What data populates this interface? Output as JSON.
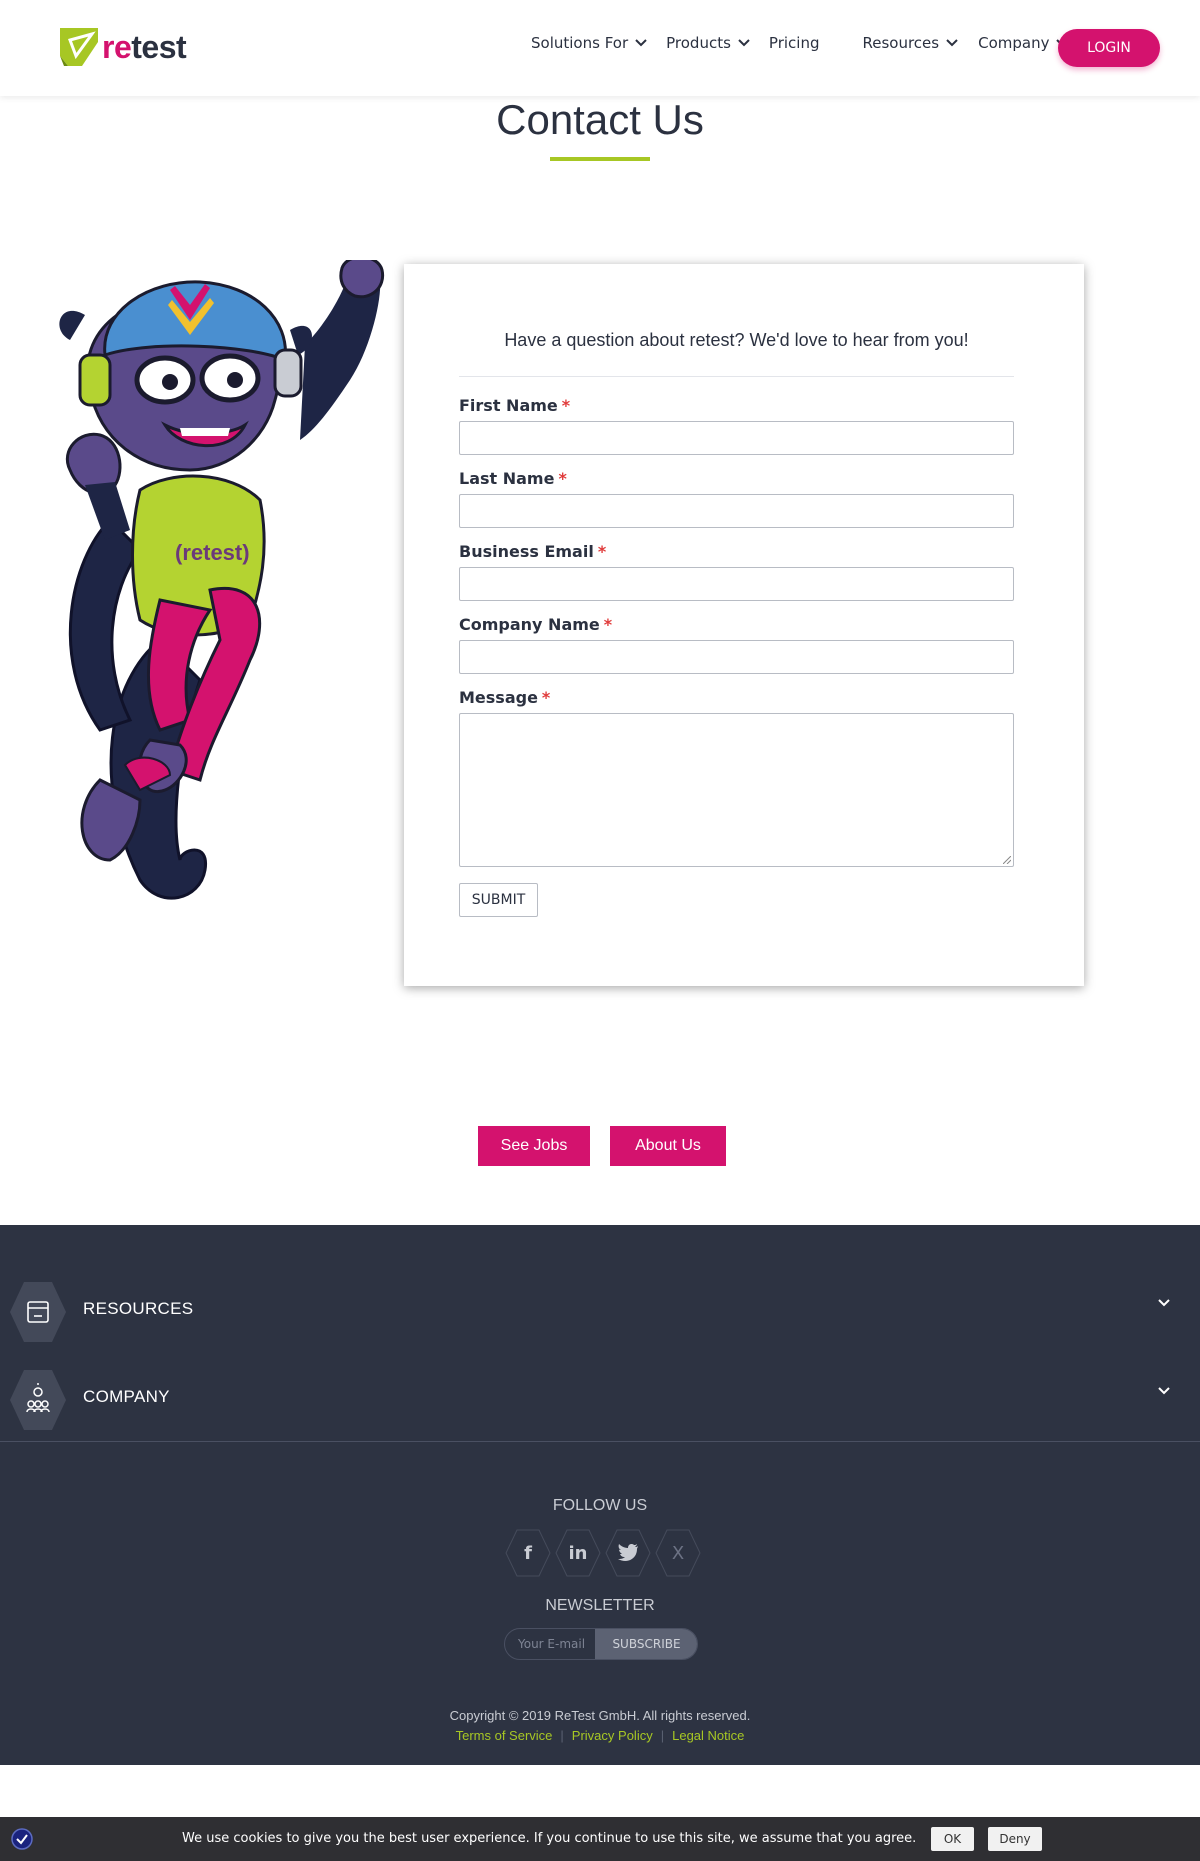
{
  "header": {
    "logo": {
      "re": "re",
      "test": "test",
      "icon": "retest-logo-icon"
    },
    "nav": [
      {
        "label": "Solutions For",
        "dropdown": true
      },
      {
        "label": "Products",
        "dropdown": true
      },
      {
        "label": "Pricing",
        "dropdown": false
      },
      {
        "label": "Resources",
        "dropdown": true
      },
      {
        "label": "Company",
        "dropdown": true
      }
    ],
    "login_label": "LOGIN"
  },
  "page": {
    "title": "Contact Us"
  },
  "form": {
    "intro": "Have a question about retest? We'd love to hear from you!",
    "required_marker": "*",
    "fields": [
      {
        "label": "First Name",
        "value": ""
      },
      {
        "label": "Last Name",
        "value": ""
      },
      {
        "label": "Business Email",
        "value": ""
      },
      {
        "label": "Company Name",
        "value": ""
      },
      {
        "label": "Message",
        "value": ""
      }
    ],
    "submit_label": "SUBMIT"
  },
  "mascot": {
    "shirt_text": "(retest)"
  },
  "cta": {
    "jobs_label": "See Jobs",
    "about_label": "About Us"
  },
  "footer": {
    "accordion": [
      {
        "label": "RESOURCES",
        "icon": "box-icon"
      },
      {
        "label": "COMPANY",
        "icon": "team-icon"
      }
    ],
    "follow_title": "FOLLOW US",
    "socials": [
      {
        "name": "facebook",
        "glyph": "f"
      },
      {
        "name": "linkedin",
        "glyph": "in"
      },
      {
        "name": "twitter",
        "glyph": ""
      },
      {
        "name": "xing",
        "glyph": "X"
      }
    ],
    "newsletter_title": "NEWSLETTER",
    "newsletter_placeholder": "Your E-mail",
    "subscribe_label": "SUBSCRIBE",
    "copyright": "Copyright © 2019 ReTest GmbH. All rights reserved.",
    "links": [
      "Terms of Service",
      "Privacy Policy",
      "Legal Notice"
    ]
  },
  "cookie": {
    "text": "We use cookies to give you the best user experience. If you continue to use this site, we assume that you agree.",
    "ok_label": "OK",
    "deny_label": "Deny"
  },
  "colors": {
    "brand_pink": "#d4126e",
    "brand_green": "#a7c724",
    "footer_bg": "#2d3342"
  }
}
